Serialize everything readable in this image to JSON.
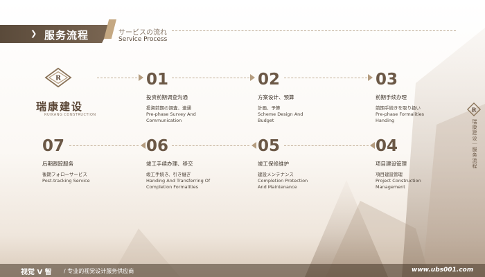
{
  "header": {
    "title_cn": "服务流程",
    "title_jp": "サービスの流れ",
    "title_en": "Service Process"
  },
  "logo": {
    "name_cn": "瑞康建设",
    "name_en": "RUIKANG CONSTRUCTION"
  },
  "steps": [
    {
      "num": "01",
      "title": "投资前期调查沟通",
      "desc": "投資前期の調査、連通\nPre-phase Survey And\nCommunication"
    },
    {
      "num": "02",
      "title": "方案设计、预算",
      "desc": "計画、予算\nScheme Design And\nBudget"
    },
    {
      "num": "03",
      "title": "前期手续办理",
      "desc": "前期手続きを取り扱い\nPre-phase Formalities\nHanding"
    },
    {
      "num": "04",
      "title": "项目建设管理",
      "desc": "項目建設管理\nProject Construction\nManagement"
    },
    {
      "num": "05",
      "title": "竣工保修维护",
      "desc": "建設メンテナンス\nCompletion Protection\nAnd Maintenance"
    },
    {
      "num": "06",
      "title": "竣工手续办理、移交",
      "desc": "竣工手続き、引き継ぎ\nHanding  And Transferring Of\nCompletion Formalities"
    },
    {
      "num": "07",
      "title": "后期跟踪服务",
      "desc": "後期フォローサービス\nPost-tracking Service"
    }
  ],
  "side": {
    "text": "瑞康建设｜服务流程"
  },
  "footer": {
    "brand": "视觉 V 智",
    "slogan": "/ 专业的视觉设计服务供应商",
    "url": "www.ubs001.com"
  },
  "colors": {
    "accent_dark": "#5a4a3a",
    "accent_gold": "#c4a882",
    "number": "#6b5846"
  }
}
